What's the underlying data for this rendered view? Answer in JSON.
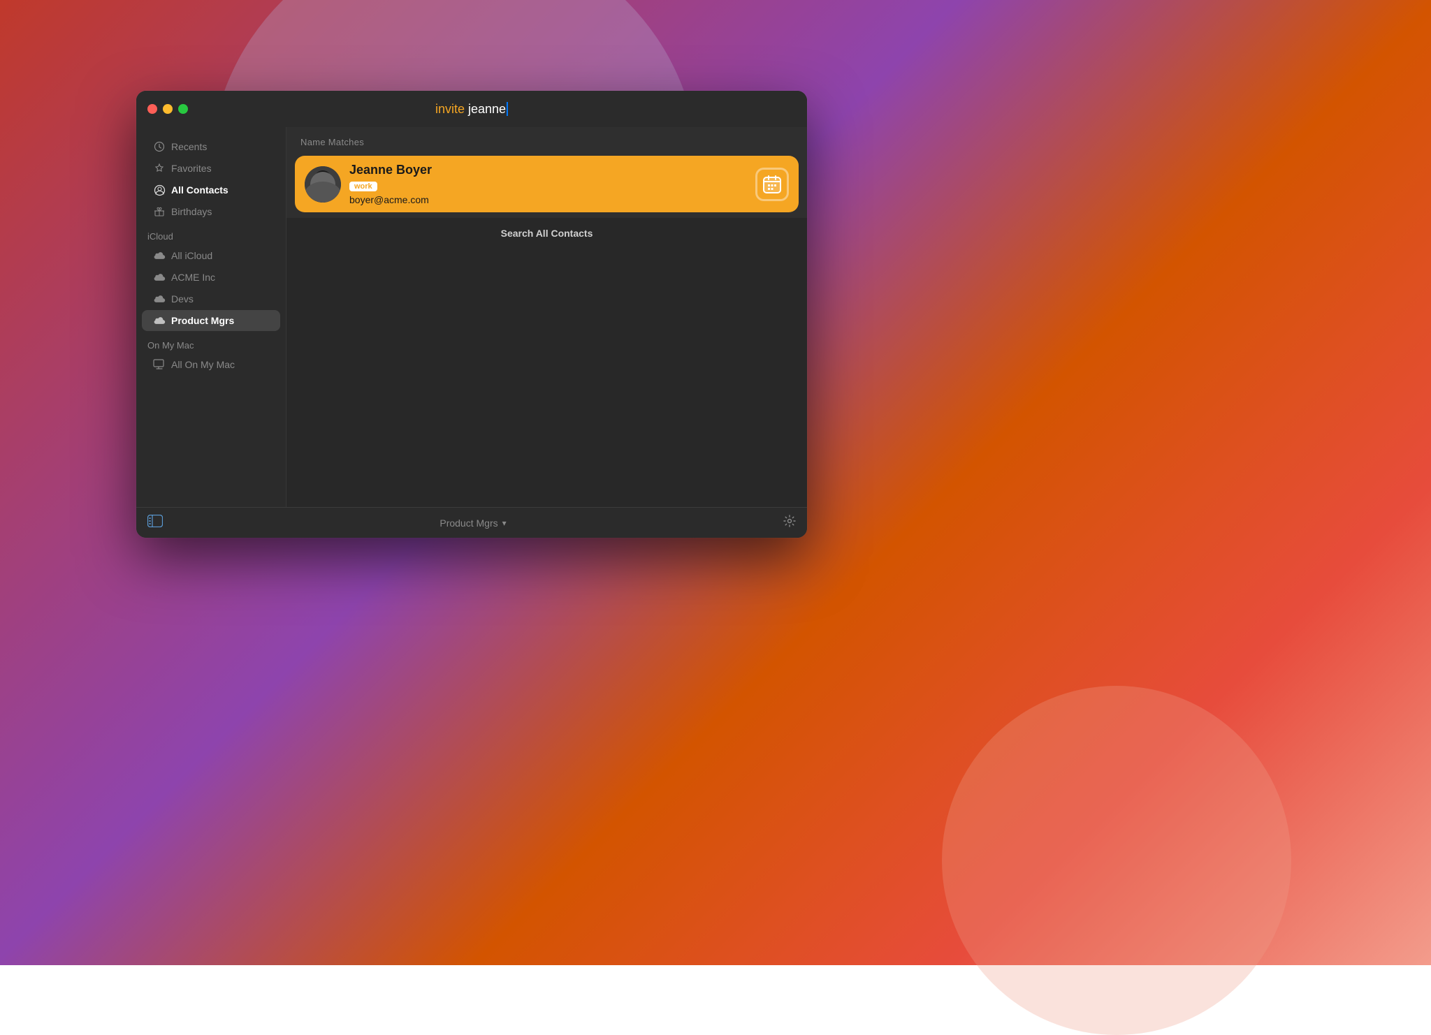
{
  "desktop": {
    "bg_colors": [
      "#c0392b",
      "#8e44ad",
      "#d35400",
      "#e74c3c"
    ]
  },
  "window": {
    "title_invite": "invite",
    "title_query": "jeanne",
    "traffic_lights": {
      "close": "close",
      "minimize": "minimize",
      "maximize": "maximize"
    }
  },
  "sidebar": {
    "items": [
      {
        "id": "recents",
        "label": "Recents",
        "icon": "clock"
      },
      {
        "id": "favorites",
        "label": "Favorites",
        "icon": "star"
      },
      {
        "id": "all-contacts",
        "label": "All Contacts",
        "icon": "person-circle",
        "active": true
      },
      {
        "id": "birthdays",
        "label": "Birthdays",
        "icon": "gift"
      }
    ],
    "sections": [
      {
        "label": "iCloud",
        "items": [
          {
            "id": "all-icloud",
            "label": "All iCloud",
            "icon": "cloud"
          },
          {
            "id": "acme-inc",
            "label": "ACME Inc",
            "icon": "cloud"
          },
          {
            "id": "devs",
            "label": "Devs",
            "icon": "cloud"
          },
          {
            "id": "product-mgrs",
            "label": "Product Mgrs",
            "icon": "cloud",
            "selected": true
          }
        ]
      },
      {
        "label": "On My Mac",
        "items": [
          {
            "id": "all-on-my-mac",
            "label": "All On My Mac",
            "icon": "mac"
          }
        ]
      }
    ]
  },
  "search_results": {
    "header": "Name Matches",
    "contact": {
      "name": "Jeanne Boyer",
      "tag": "work",
      "email": "boyer@acme.com",
      "has_avatar": true
    },
    "search_all_label": "Search All Contacts"
  },
  "bottom_bar": {
    "left_icon": "sidebar-toggle",
    "center_label": "Product Mgrs",
    "center_chevron": "▾",
    "right_icon": "gear"
  }
}
